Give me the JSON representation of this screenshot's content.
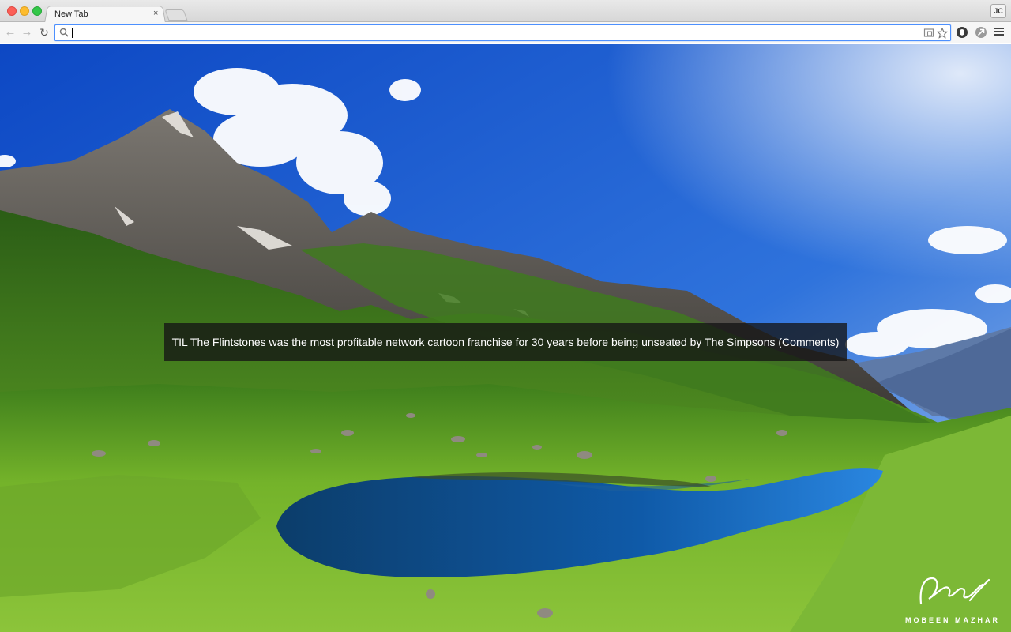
{
  "browser": {
    "tab": {
      "title": "New Tab",
      "close_glyph": "×"
    },
    "profile_initials": "JC",
    "omnibox": {
      "value": "",
      "placeholder": ""
    },
    "icons": {
      "back": "back-arrow-icon",
      "forward": "forward-arrow-icon",
      "reload": "reload-icon",
      "search": "search-icon",
      "cast": "cast-icon",
      "bookmark": "star-icon",
      "extension_1": "ghostery-icon",
      "extension_2": "extension-icon",
      "menu": "hamburger-menu-icon"
    },
    "glyphs": {
      "back": "←",
      "forward": "→",
      "reload": "↻"
    }
  },
  "background": {
    "caption": "TIL The Flintstones was the most profitable network cartoon franchise for 30 years before being unseated by The Simpsons (Comments)",
    "photographer": "MOBEEN MAZHAR"
  },
  "colors": {
    "accent": "#4d90fe",
    "sky": "#1e5fd0",
    "grass": "#6fae1f",
    "lake": "#0f4f8f"
  }
}
